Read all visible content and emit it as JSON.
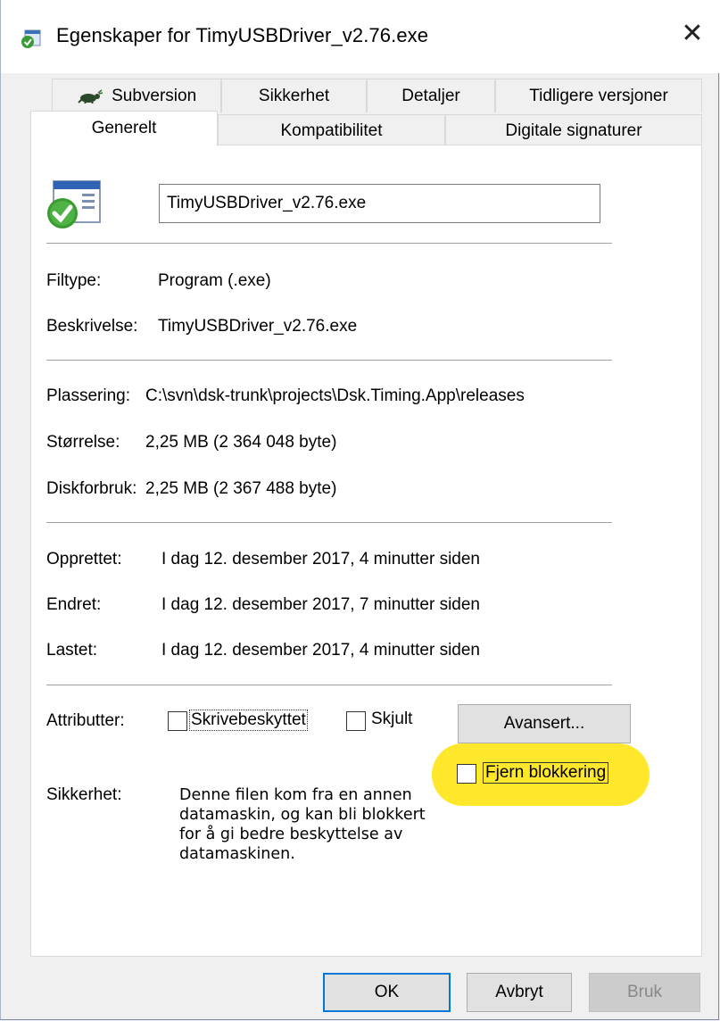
{
  "window": {
    "title": "Egenskaper for TimyUSBDriver_v2.76.exe",
    "close_glyph": "✕"
  },
  "tabs_row1": [
    {
      "label": "Subversion",
      "icon": "tortoise-svn-icon"
    },
    {
      "label": "Sikkerhet"
    },
    {
      "label": "Detaljer"
    },
    {
      "label": "Tidligere versjoner"
    }
  ],
  "tabs_row2": [
    {
      "label": "Generelt",
      "active": true
    },
    {
      "label": "Kompatibilitet"
    },
    {
      "label": "Digitale signaturer"
    }
  ],
  "general": {
    "filename": "TimyUSBDriver_v2.76.exe",
    "filetype_label": "Filtype:",
    "filetype_value": "Program (.exe)",
    "description_label": "Beskrivelse:",
    "description_value": "TimyUSBDriver_v2.76.exe",
    "location_label": "Plassering:",
    "location_value": "C:\\svn\\dsk-trunk\\projects\\Dsk.Timing.App\\releases",
    "size_label": "Størrelse:",
    "size_value": "2,25 MB (2 364 048 byte)",
    "disk_label": "Diskforbruk:",
    "disk_value": "2,25 MB (2 367 488 byte)",
    "created_label": "Opprettet:",
    "created_value": "I dag 12. desember 2017, 4 minutter siden",
    "modified_label": "Endret:",
    "modified_value": "I dag 12. desember 2017, 7 minutter siden",
    "accessed_label": "Lastet:",
    "accessed_value": "I dag 12. desember 2017, 4 minutter siden",
    "attributes_label": "Attributter:",
    "readonly_label": "Skrivebeskyttet",
    "hidden_label": "Skjult",
    "advanced_button": "Avansert...",
    "unblock_label": "Fjern blokkering",
    "security_label": "Sikkerhet:",
    "security_text_lines": [
      "Denne filen kom fra en annen",
      "datamaskin, og kan bli blokkert",
      "for å gi bedre beskyttelse av",
      "datamaskinen."
    ],
    "highlight_color": "#ffe82b"
  },
  "footer": {
    "ok": "OK",
    "cancel": "Avbryt",
    "apply": "Bruk"
  }
}
